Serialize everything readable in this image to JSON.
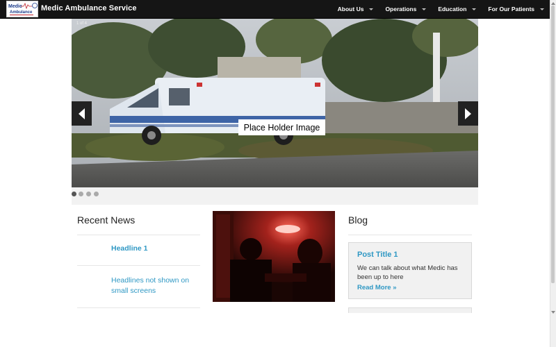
{
  "header": {
    "logo_text_top": "Medic",
    "logo_text_bottom": "Ambulance",
    "brand": "Medic Ambulance Service",
    "nav": [
      {
        "label": "About Us"
      },
      {
        "label": "Operations"
      },
      {
        "label": "Education"
      },
      {
        "label": "For Our Patients"
      }
    ]
  },
  "carousel": {
    "counter": "1 of 4",
    "placeholder_label": "Place Holder Image",
    "slide_count": 4,
    "active_index": 0
  },
  "news": {
    "title": "Recent News",
    "items": [
      {
        "label": "Headline 1"
      },
      {
        "label": "Headlines not shown on small screens"
      }
    ]
  },
  "blog": {
    "title": "Blog",
    "post": {
      "title": "Post Title 1",
      "body": "We can talk about what Medic has been up to here",
      "more": "Read More »"
    }
  },
  "colors": {
    "nav_bg": "#151515",
    "link": "#2f98c4"
  }
}
